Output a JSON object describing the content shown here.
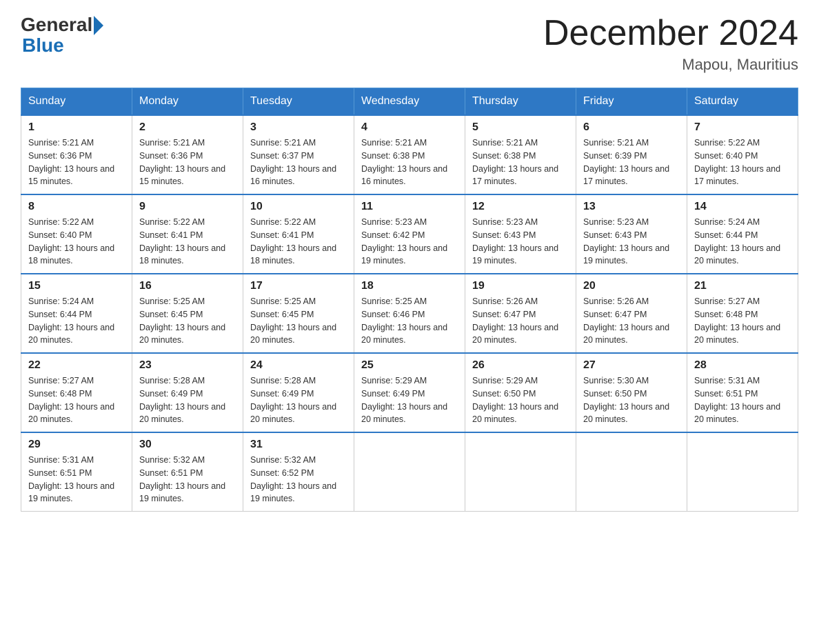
{
  "logo": {
    "text_general": "General",
    "text_blue": "Blue",
    "triangle_color": "#1a6eb5"
  },
  "header": {
    "month_year": "December 2024",
    "location": "Mapou, Mauritius"
  },
  "days_of_week": [
    "Sunday",
    "Monday",
    "Tuesday",
    "Wednesday",
    "Thursday",
    "Friday",
    "Saturday"
  ],
  "weeks": [
    [
      {
        "day": "1",
        "sunrise": "5:21 AM",
        "sunset": "6:36 PM",
        "daylight": "13 hours and 15 minutes."
      },
      {
        "day": "2",
        "sunrise": "5:21 AM",
        "sunset": "6:36 PM",
        "daylight": "13 hours and 15 minutes."
      },
      {
        "day": "3",
        "sunrise": "5:21 AM",
        "sunset": "6:37 PM",
        "daylight": "13 hours and 16 minutes."
      },
      {
        "day": "4",
        "sunrise": "5:21 AM",
        "sunset": "6:38 PM",
        "daylight": "13 hours and 16 minutes."
      },
      {
        "day": "5",
        "sunrise": "5:21 AM",
        "sunset": "6:38 PM",
        "daylight": "13 hours and 17 minutes."
      },
      {
        "day": "6",
        "sunrise": "5:21 AM",
        "sunset": "6:39 PM",
        "daylight": "13 hours and 17 minutes."
      },
      {
        "day": "7",
        "sunrise": "5:22 AM",
        "sunset": "6:40 PM",
        "daylight": "13 hours and 17 minutes."
      }
    ],
    [
      {
        "day": "8",
        "sunrise": "5:22 AM",
        "sunset": "6:40 PM",
        "daylight": "13 hours and 18 minutes."
      },
      {
        "day": "9",
        "sunrise": "5:22 AM",
        "sunset": "6:41 PM",
        "daylight": "13 hours and 18 minutes."
      },
      {
        "day": "10",
        "sunrise": "5:22 AM",
        "sunset": "6:41 PM",
        "daylight": "13 hours and 18 minutes."
      },
      {
        "day": "11",
        "sunrise": "5:23 AM",
        "sunset": "6:42 PM",
        "daylight": "13 hours and 19 minutes."
      },
      {
        "day": "12",
        "sunrise": "5:23 AM",
        "sunset": "6:43 PM",
        "daylight": "13 hours and 19 minutes."
      },
      {
        "day": "13",
        "sunrise": "5:23 AM",
        "sunset": "6:43 PM",
        "daylight": "13 hours and 19 minutes."
      },
      {
        "day": "14",
        "sunrise": "5:24 AM",
        "sunset": "6:44 PM",
        "daylight": "13 hours and 20 minutes."
      }
    ],
    [
      {
        "day": "15",
        "sunrise": "5:24 AM",
        "sunset": "6:44 PM",
        "daylight": "13 hours and 20 minutes."
      },
      {
        "day": "16",
        "sunrise": "5:25 AM",
        "sunset": "6:45 PM",
        "daylight": "13 hours and 20 minutes."
      },
      {
        "day": "17",
        "sunrise": "5:25 AM",
        "sunset": "6:45 PM",
        "daylight": "13 hours and 20 minutes."
      },
      {
        "day": "18",
        "sunrise": "5:25 AM",
        "sunset": "6:46 PM",
        "daylight": "13 hours and 20 minutes."
      },
      {
        "day": "19",
        "sunrise": "5:26 AM",
        "sunset": "6:47 PM",
        "daylight": "13 hours and 20 minutes."
      },
      {
        "day": "20",
        "sunrise": "5:26 AM",
        "sunset": "6:47 PM",
        "daylight": "13 hours and 20 minutes."
      },
      {
        "day": "21",
        "sunrise": "5:27 AM",
        "sunset": "6:48 PM",
        "daylight": "13 hours and 20 minutes."
      }
    ],
    [
      {
        "day": "22",
        "sunrise": "5:27 AM",
        "sunset": "6:48 PM",
        "daylight": "13 hours and 20 minutes."
      },
      {
        "day": "23",
        "sunrise": "5:28 AM",
        "sunset": "6:49 PM",
        "daylight": "13 hours and 20 minutes."
      },
      {
        "day": "24",
        "sunrise": "5:28 AM",
        "sunset": "6:49 PM",
        "daylight": "13 hours and 20 minutes."
      },
      {
        "day": "25",
        "sunrise": "5:29 AM",
        "sunset": "6:49 PM",
        "daylight": "13 hours and 20 minutes."
      },
      {
        "day": "26",
        "sunrise": "5:29 AM",
        "sunset": "6:50 PM",
        "daylight": "13 hours and 20 minutes."
      },
      {
        "day": "27",
        "sunrise": "5:30 AM",
        "sunset": "6:50 PM",
        "daylight": "13 hours and 20 minutes."
      },
      {
        "day": "28",
        "sunrise": "5:31 AM",
        "sunset": "6:51 PM",
        "daylight": "13 hours and 20 minutes."
      }
    ],
    [
      {
        "day": "29",
        "sunrise": "5:31 AM",
        "sunset": "6:51 PM",
        "daylight": "13 hours and 19 minutes."
      },
      {
        "day": "30",
        "sunrise": "5:32 AM",
        "sunset": "6:51 PM",
        "daylight": "13 hours and 19 minutes."
      },
      {
        "day": "31",
        "sunrise": "5:32 AM",
        "sunset": "6:52 PM",
        "daylight": "13 hours and 19 minutes."
      },
      null,
      null,
      null,
      null
    ]
  ]
}
